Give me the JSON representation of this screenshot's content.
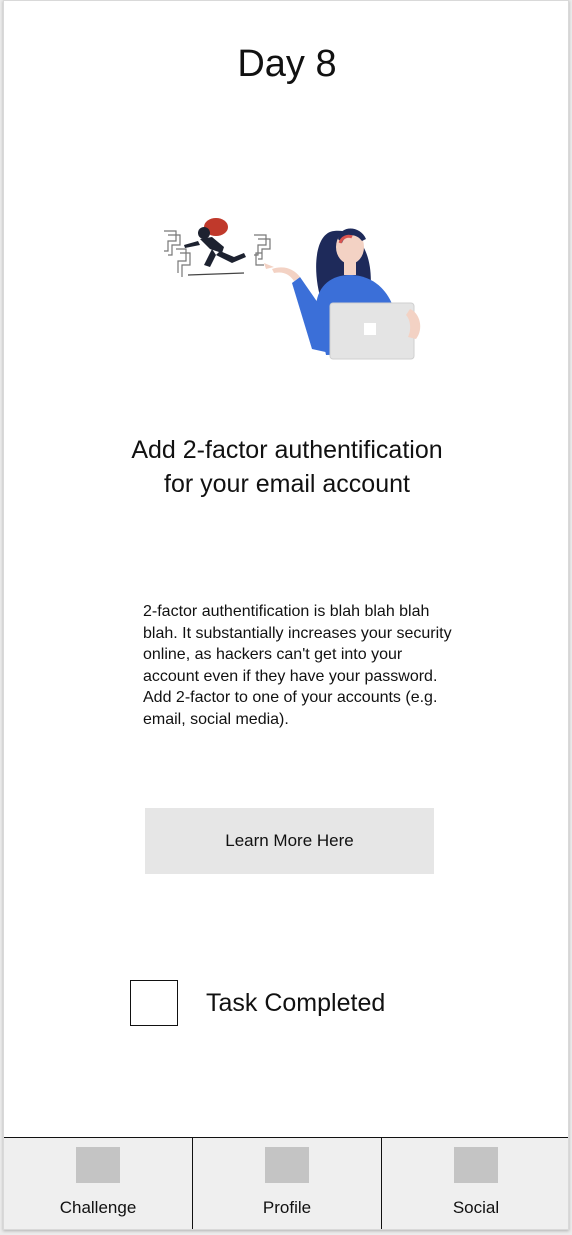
{
  "header": {
    "title": "Day 8"
  },
  "illustration": {
    "icon": "thief-and-woman-with-laptop-illustration"
  },
  "task": {
    "heading_line1": "Add 2-factor authentification",
    "heading_line2": "for your email account",
    "description": "2-factor authentification is blah blah blah blah. It substantially increases your security online, as hackers can't get into your account even if they have your password. Add 2-factor to one of your accounts (e.g. email, social media).",
    "learn_more_label": "Learn More Here",
    "completed_label": "Task Completed",
    "completed": false
  },
  "tabs": [
    {
      "label": "Challenge",
      "icon": "challenge-icon"
    },
    {
      "label": "Profile",
      "icon": "profile-icon"
    },
    {
      "label": "Social",
      "icon": "social-icon"
    }
  ],
  "colors": {
    "accent_blue": "#3b6fd8",
    "hair": "#1e2a5a",
    "thief_bag": "#c0392b",
    "button_bg": "#e6e6e6",
    "placeholder_icon": "#c4c4c4"
  }
}
